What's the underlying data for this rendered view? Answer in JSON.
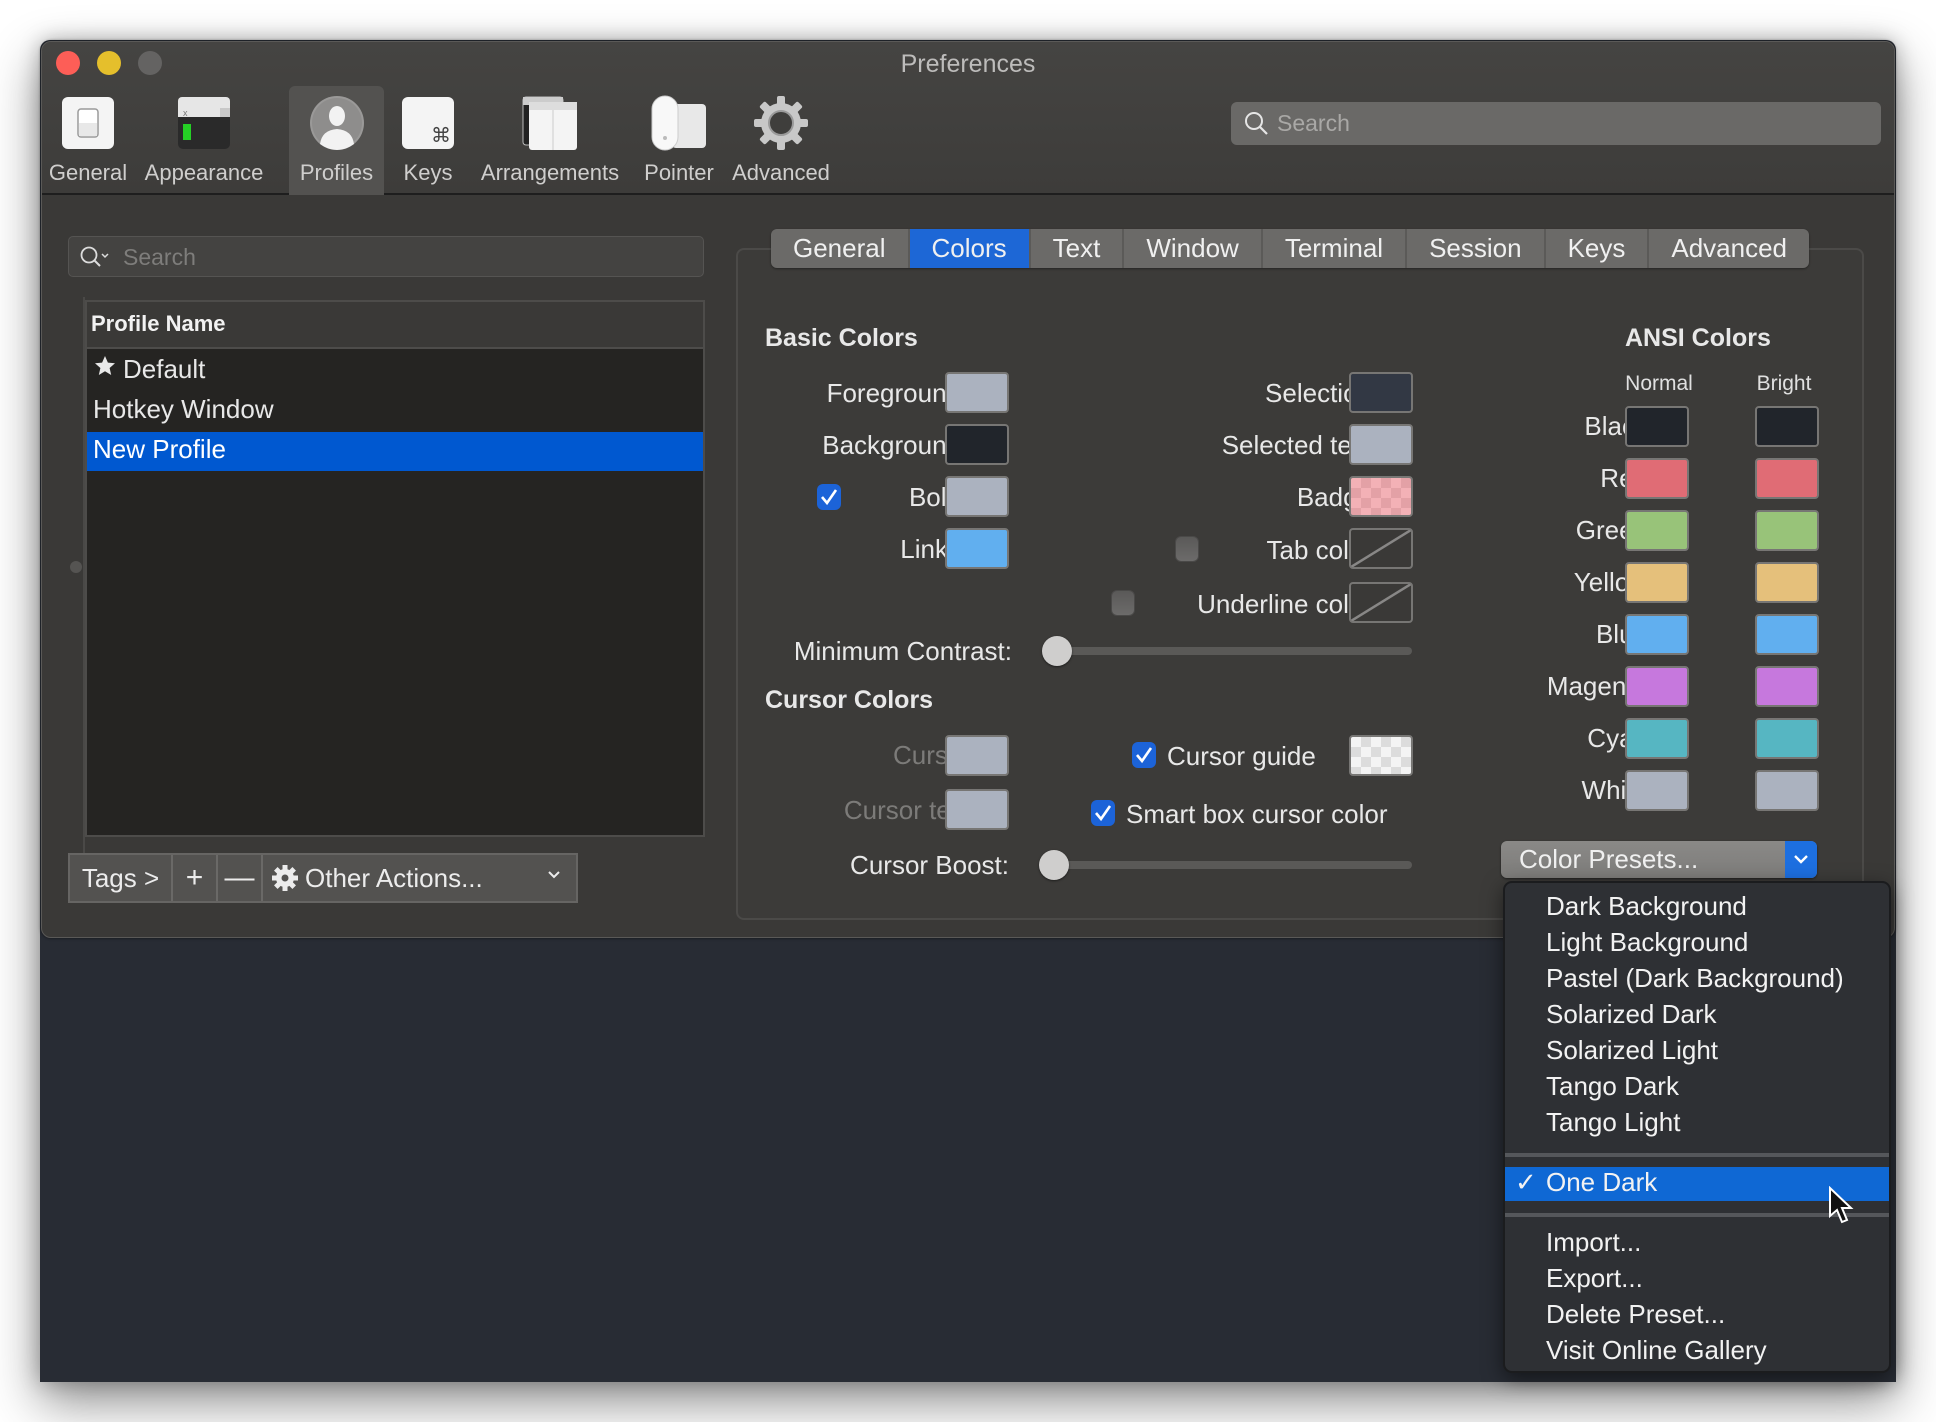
{
  "window": {
    "title": "Preferences"
  },
  "toolbar": {
    "items": [
      {
        "label": "General",
        "icon": "general-switch-icon",
        "active": false
      },
      {
        "label": "Appearance",
        "icon": "appearance-terminal-icon",
        "active": false
      },
      {
        "label": "Profiles",
        "icon": "profile-person-icon",
        "active": true
      },
      {
        "label": "Keys",
        "icon": "keys-command-icon",
        "active": false
      },
      {
        "label": "Arrangements",
        "icon": "arrangements-windows-icon",
        "active": false
      },
      {
        "label": "Pointer",
        "icon": "pointer-mouse-icon",
        "active": false
      },
      {
        "label": "Advanced",
        "icon": "advanced-gear-icon",
        "active": false
      }
    ],
    "search_placeholder": "Search"
  },
  "profiles": {
    "search_placeholder": "Search",
    "column_header": "Profile Name",
    "rows": [
      {
        "name": "Default",
        "default": true,
        "selected": false
      },
      {
        "name": "Hotkey Window",
        "default": false,
        "selected": false
      },
      {
        "name": "New Profile",
        "default": false,
        "selected": true
      }
    ],
    "buttons": {
      "tags": "Tags >",
      "add": "+",
      "remove": "—",
      "other_actions": "Other Actions..."
    }
  },
  "tabs": [
    {
      "label": "General",
      "active": false
    },
    {
      "label": "Colors",
      "active": true
    },
    {
      "label": "Text",
      "active": false
    },
    {
      "label": "Window",
      "active": false
    },
    {
      "label": "Terminal",
      "active": false
    },
    {
      "label": "Session",
      "active": false
    },
    {
      "label": "Keys",
      "active": false
    },
    {
      "label": "Advanced",
      "active": false
    }
  ],
  "basic_colors": {
    "heading": "Basic Colors",
    "foreground": {
      "label": "Foreground",
      "color": "#abb2bf"
    },
    "background": {
      "label": "Background",
      "color": "#21252b"
    },
    "bold": {
      "label": "Bold",
      "checked": true,
      "color": "#abb2bf"
    },
    "links": {
      "label": "Links",
      "color": "#61afef"
    },
    "selection": {
      "label": "Selection",
      "color": "#323844"
    },
    "selected_text": {
      "label": "Selected text",
      "color": "#abb2bf"
    },
    "badge": {
      "label": "Badge",
      "color": "#f3b1b6",
      "checker": "#e3a1a6"
    },
    "tab_color": {
      "label": "Tab color",
      "checked": false
    },
    "underline_color": {
      "label": "Underline color",
      "checked": false
    },
    "minimum_contrast": {
      "label": "Minimum Contrast:",
      "value": 0
    }
  },
  "cursor_colors": {
    "heading": "Cursor Colors",
    "cursor": {
      "label": "Cursor",
      "color": "#abb2bf"
    },
    "cursor_text": {
      "label": "Cursor text",
      "color": "#abb2bf"
    },
    "cursor_guide": {
      "label": "Cursor guide",
      "checked": true,
      "color": "#f4f4f4",
      "checker": "#dcdcdc"
    },
    "smart_box": {
      "label": "Smart box cursor color",
      "checked": true
    },
    "cursor_boost": {
      "label": "Cursor Boost:",
      "value": 0
    }
  },
  "ansi": {
    "heading": "ANSI Colors",
    "col_normal": "Normal",
    "col_bright": "Bright",
    "rows": [
      {
        "name": "Black",
        "normal": "#21252b",
        "bright": "#21252b"
      },
      {
        "name": "Red",
        "normal": "#e06c75",
        "bright": "#e06c75"
      },
      {
        "name": "Green",
        "normal": "#98c379",
        "bright": "#98c379"
      },
      {
        "name": "Yellow",
        "normal": "#e5c07b",
        "bright": "#e5c07b"
      },
      {
        "name": "Blue",
        "normal": "#61afef",
        "bright": "#61afef"
      },
      {
        "name": "Magenta",
        "normal": "#c678dd",
        "bright": "#c678dd"
      },
      {
        "name": "Cyan",
        "normal": "#56b6c2",
        "bright": "#56b6c2"
      },
      {
        "name": "White",
        "normal": "#abb2bf",
        "bright": "#abb2bf"
      }
    ]
  },
  "presets": {
    "button_label": "Color Presets...",
    "menu_group1": [
      "Dark Background",
      "Light Background",
      "Pastel (Dark Background)",
      "Solarized Dark",
      "Solarized Light",
      "Tango Dark",
      "Tango Light"
    ],
    "selected": {
      "label": "One Dark",
      "check": "✓"
    },
    "menu_group3": [
      "Import...",
      "Export...",
      "Delete Preset...",
      "Visit Online Gallery"
    ]
  },
  "colors": {
    "accent": "#1d67d6",
    "selection_row": "#0058d0",
    "window_bg": "#3a3937",
    "terminal_bg": "#282c34"
  }
}
